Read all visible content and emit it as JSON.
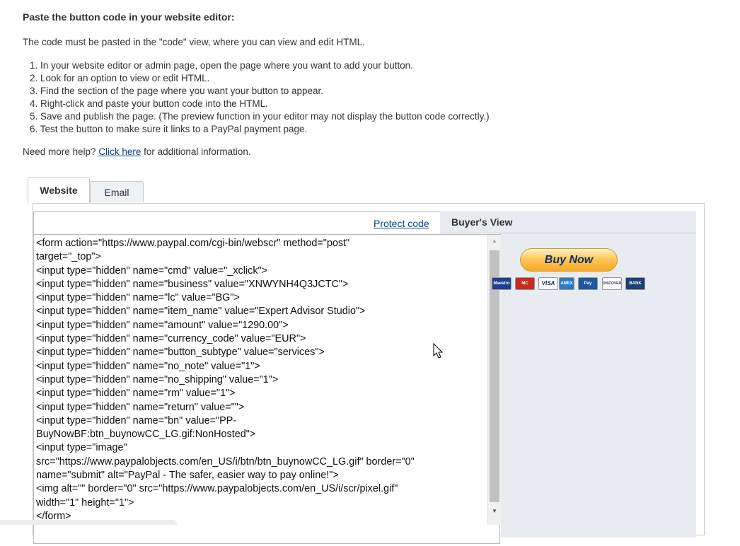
{
  "heading": "Paste the button code in your website editor:",
  "intro": "The code must be pasted in the \"code\" view, where you can view and edit HTML.",
  "steps": [
    "1. In your website editor or admin page, open the page where you want to add your button.",
    "2. Look for an option to view or edit HTML.",
    "3. Find the section of the page where you want your button to appear.",
    "4. Right-click and paste your button code into the HTML.",
    "5. Save and publish the page. (The preview function in your editor may not display the button code correctly.)",
    "6. Test the button to make sure it links to a PayPal payment page."
  ],
  "help": {
    "prefix": "Need more help? ",
    "link": "Click here",
    "suffix": " for additional information."
  },
  "tabs": {
    "website": "Website",
    "email": "Email"
  },
  "code_panel": {
    "protect_link": "Protect code",
    "code": "<form action=\"https://www.paypal.com/cgi-bin/webscr\" method=\"post\"\ntarget=\"_top\">\n<input type=\"hidden\" name=\"cmd\" value=\"_xclick\">\n<input type=\"hidden\" name=\"business\" value=\"XNWYNH4Q3JCTC\">\n<input type=\"hidden\" name=\"lc\" value=\"BG\">\n<input type=\"hidden\" name=\"item_name\" value=\"Expert Advisor Studio\">\n<input type=\"hidden\" name=\"amount\" value=\"1290.00\">\n<input type=\"hidden\" name=\"currency_code\" value=\"EUR\">\n<input type=\"hidden\" name=\"button_subtype\" value=\"services\">\n<input type=\"hidden\" name=\"no_note\" value=\"1\">\n<input type=\"hidden\" name=\"no_shipping\" value=\"1\">\n<input type=\"hidden\" name=\"rm\" value=\"1\">\n<input type=\"hidden\" name=\"return\" value=\"\">\n<input type=\"hidden\" name=\"bn\" value=\"PP-\nBuyNowBF:btn_buynowCC_LG.gif:NonHosted\">\n<input type=\"image\"\nsrc=\"https://www.paypalobjects.com/en_US/i/btn/btn_buynowCC_LG.gif\" border=\"0\"\nname=\"submit\" alt=\"PayPal - The safer, easier way to pay online!\">\n<img alt=\"\" border=\"0\" src=\"https://www.paypalobjects.com/en_US/i/scr/pixel.gif\"\nwidth=\"1\" height=\"1\">\n</form>"
  },
  "buyer_view": {
    "title": "Buyer's View",
    "button_label": "Buy Now",
    "cards": [
      {
        "icon": "maestro-icon",
        "label": "Maestro",
        "color": "#cc0000"
      },
      {
        "icon": "mastercard-icon",
        "label": "MC",
        "color": "#cc2200"
      },
      {
        "icon": "visa-icon",
        "label": "VISA",
        "color": "#ffffff"
      },
      {
        "icon": "amex-icon",
        "label": "AMEX",
        "color": "#2a7bc4"
      },
      {
        "icon": "clearpay-icon",
        "label": "Pay",
        "color": "#1f56a3"
      },
      {
        "icon": "discover-icon",
        "label": "DISCOVER",
        "color": "#ffffff"
      },
      {
        "icon": "bank-icon",
        "label": "BANK",
        "color": "#1b3f73"
      }
    ]
  }
}
